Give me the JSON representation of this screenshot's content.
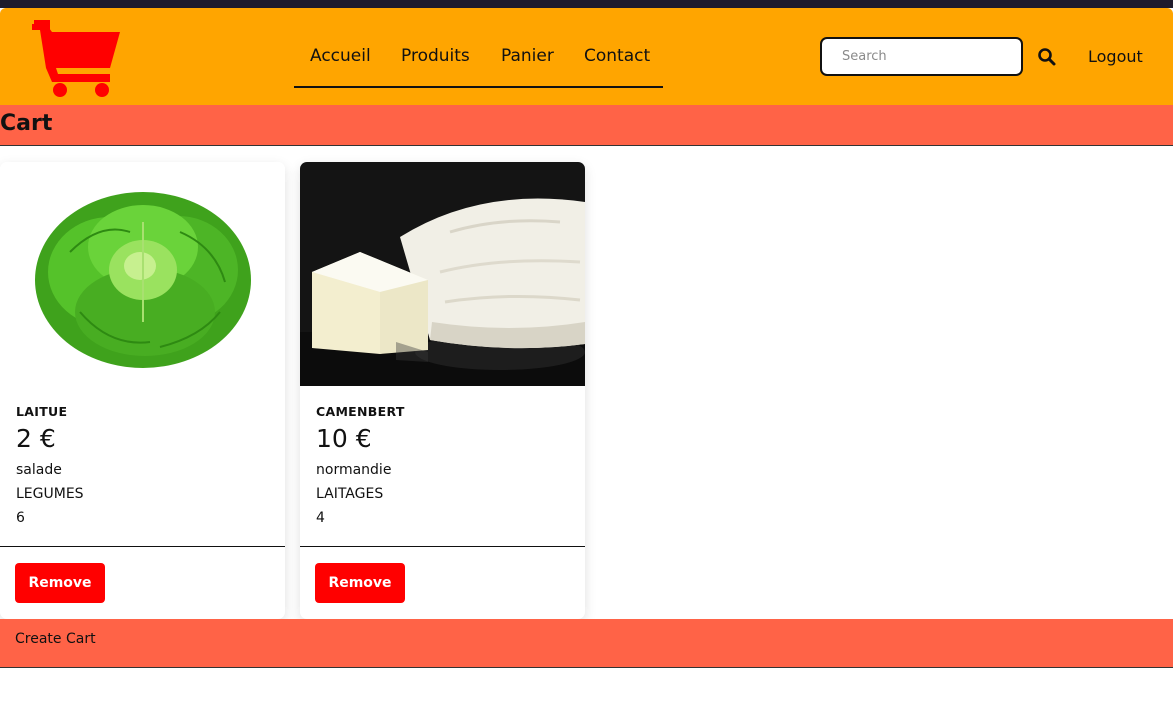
{
  "nav": {
    "logo_icon": "shopping-cart-icon",
    "links": [
      "Accueil",
      "Produits",
      "Panier",
      "Contact"
    ],
    "search_placeholder": "Search",
    "search_icon": "search-icon",
    "logout_label": "Logout"
  },
  "colors": {
    "navbar": "#ffa500",
    "header_band": "#ff6347",
    "logo": "#ff0000",
    "remove_button": "#ff0000"
  },
  "cart": {
    "title": "Cart",
    "items": [
      {
        "name": "LAITUE",
        "price": "2 €",
        "description": "salade",
        "category": "LEGUMES",
        "quantity": "6",
        "remove_label": "Remove"
      },
      {
        "name": "CAMENBERT",
        "price": "10 €",
        "description": "normandie",
        "category": "LAITAGES",
        "quantity": "4",
        "remove_label": "Remove"
      }
    ],
    "create_label": "Create Cart"
  }
}
